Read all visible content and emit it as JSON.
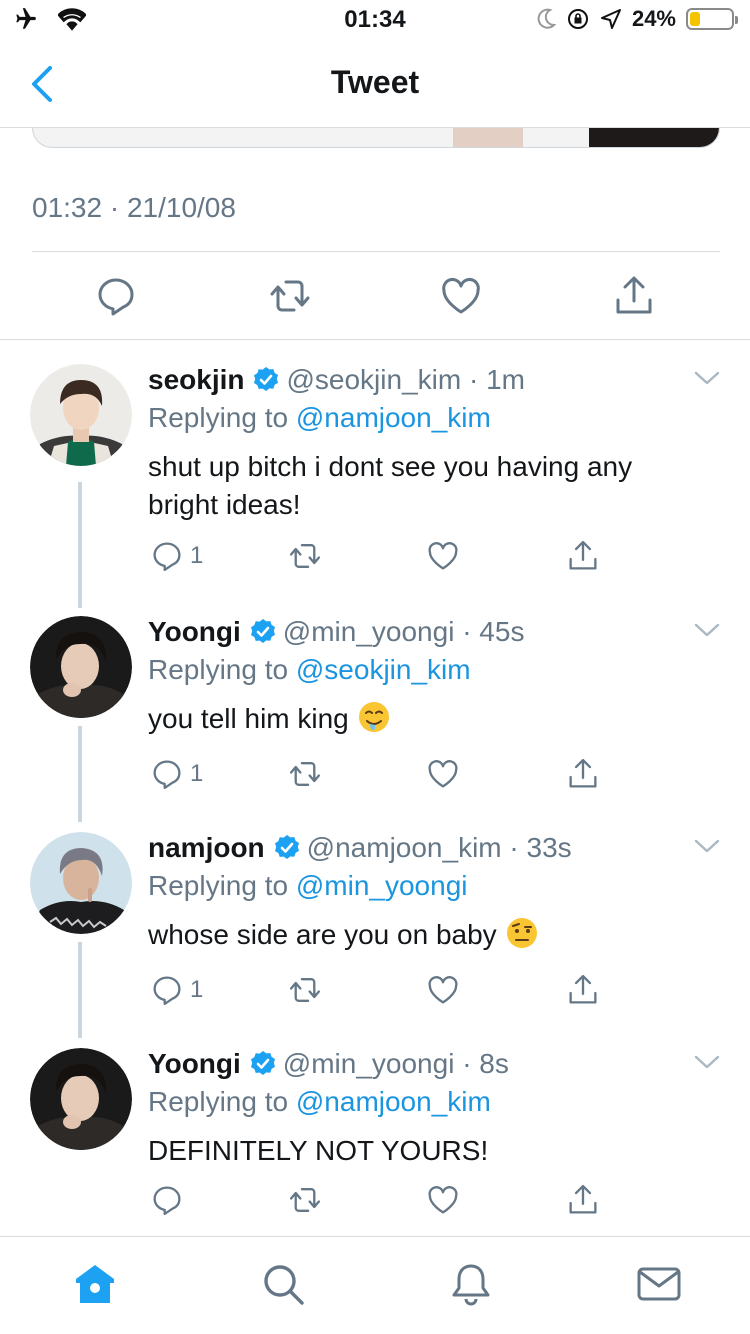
{
  "status_bar": {
    "time": "01:34",
    "battery": "24%",
    "battery_level": 0.24,
    "icons": [
      "airplane-icon",
      "wifi-icon",
      "moon-icon",
      "orientation-lock-icon",
      "location-icon",
      "battery-icon"
    ]
  },
  "header": {
    "title": "Tweet",
    "back_icon": "chevron-left-icon"
  },
  "main_tweet": {
    "timestamp": "01:32 · 21/10/08",
    "actions": [
      "reply-icon",
      "retweet-icon",
      "like-icon",
      "share-icon"
    ]
  },
  "replies": [
    {
      "name": "seokjin",
      "handle": "@seokjin_kim · 1m",
      "replying_prefix": "Replying to",
      "replying_to": "@namjoon_kim",
      "text": "shut up bitch i dont see you having any bright ideas!",
      "emoji": "",
      "reply_count": "1"
    },
    {
      "name": "Yoongi",
      "handle": "@min_yoongi · 45s",
      "replying_prefix": "Replying to",
      "replying_to": "@seokjin_kim",
      "text": "you tell him king",
      "emoji": "drooling-face",
      "reply_count": "1"
    },
    {
      "name": "namjoon",
      "handle": "@namjoon_kim · 33s",
      "replying_prefix": "Replying to",
      "replying_to": "@min_yoongi",
      "text": "whose side are you on baby",
      "emoji": "raised-eyebrow-face",
      "reply_count": "1"
    },
    {
      "name": "Yoongi",
      "handle": "@min_yoongi · 8s",
      "replying_prefix": "Replying to",
      "replying_to": "@namjoon_kim",
      "text": "DEFINITELY NOT YOURS!",
      "emoji": "",
      "reply_count": ""
    }
  ],
  "tab_bar": {
    "items": [
      "home-icon",
      "search-icon",
      "notifications-icon",
      "messages-icon"
    ],
    "active": "home-icon"
  },
  "colors": {
    "accent": "#1da1f2",
    "mention": "#1b95e0",
    "secondary_text": "#657786",
    "divider": "#d8dde1"
  }
}
